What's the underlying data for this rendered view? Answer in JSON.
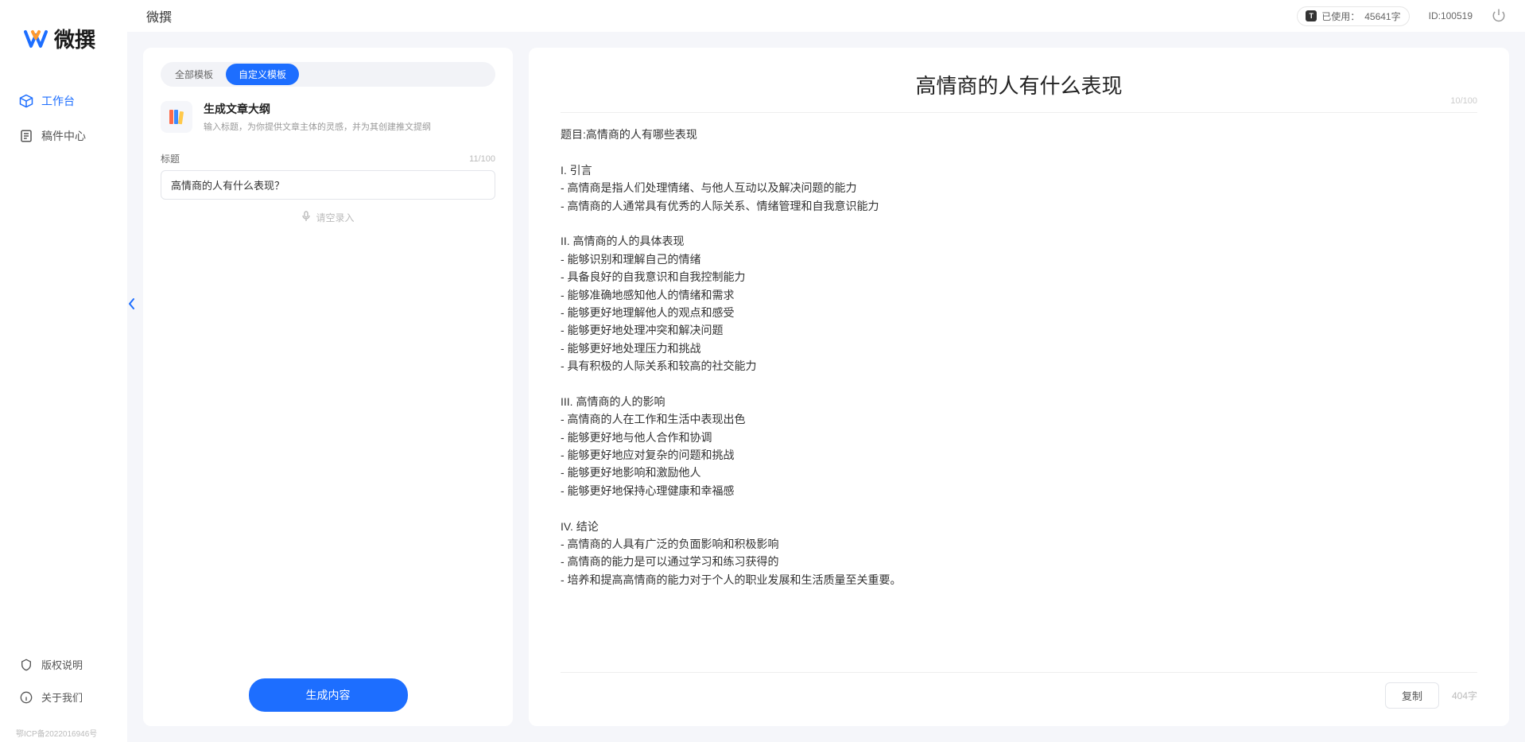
{
  "app": {
    "name": "微撰",
    "logo_text": "微撰"
  },
  "sidebar": {
    "items": [
      {
        "label": "工作台",
        "icon": "cube-icon",
        "active": true
      },
      {
        "label": "稿件中心",
        "icon": "doc-icon",
        "active": false
      }
    ],
    "bottom": [
      {
        "label": "版权说明",
        "icon": "shield-icon"
      },
      {
        "label": "关于我们",
        "icon": "info-icon"
      }
    ],
    "icp": "鄂ICP备2022016946号"
  },
  "topbar": {
    "title": "微撰",
    "usage_label": "已使用：",
    "usage_value": "45641字",
    "id_label": "ID:",
    "id_value": "100519"
  },
  "tabs": {
    "all": "全部模板",
    "custom": "自定义模板"
  },
  "template": {
    "title": "生成文章大纲",
    "desc": "输入标题，为你提供文章主体的灵感，并为其创建推文提纲"
  },
  "form": {
    "title_label": "标题",
    "title_count": "11/100",
    "title_value": "高情商的人有什么表现？",
    "voice_hint": "请空录入",
    "generate_label": "生成内容"
  },
  "output": {
    "title": "高情商的人有什么表现",
    "title_count": "10/100",
    "body": "题目:高情商的人有哪些表现\n\nI. 引言\n- 高情商是指人们处理情绪、与他人互动以及解决问题的能力\n- 高情商的人通常具有优秀的人际关系、情绪管理和自我意识能力\n\nII. 高情商的人的具体表现\n- 能够识别和理解自己的情绪\n- 具备良好的自我意识和自我控制能力\n- 能够准确地感知他人的情绪和需求\n- 能够更好地理解他人的观点和感受\n- 能够更好地处理冲突和解决问题\n- 能够更好地处理压力和挑战\n- 具有积极的人际关系和较高的社交能力\n\nIII. 高情商的人的影响\n- 高情商的人在工作和生活中表现出色\n- 能够更好地与他人合作和协调\n- 能够更好地应对复杂的问题和挑战\n- 能够更好地影响和激励他人\n- 能够更好地保持心理健康和幸福感\n\nIV. 结论\n- 高情商的人具有广泛的负面影响和积极影响\n- 高情商的能力是可以通过学习和练习获得的\n- 培养和提高高情商的能力对于个人的职业发展和生活质量至关重要。",
    "copy_label": "复制",
    "word_count": "404字"
  }
}
